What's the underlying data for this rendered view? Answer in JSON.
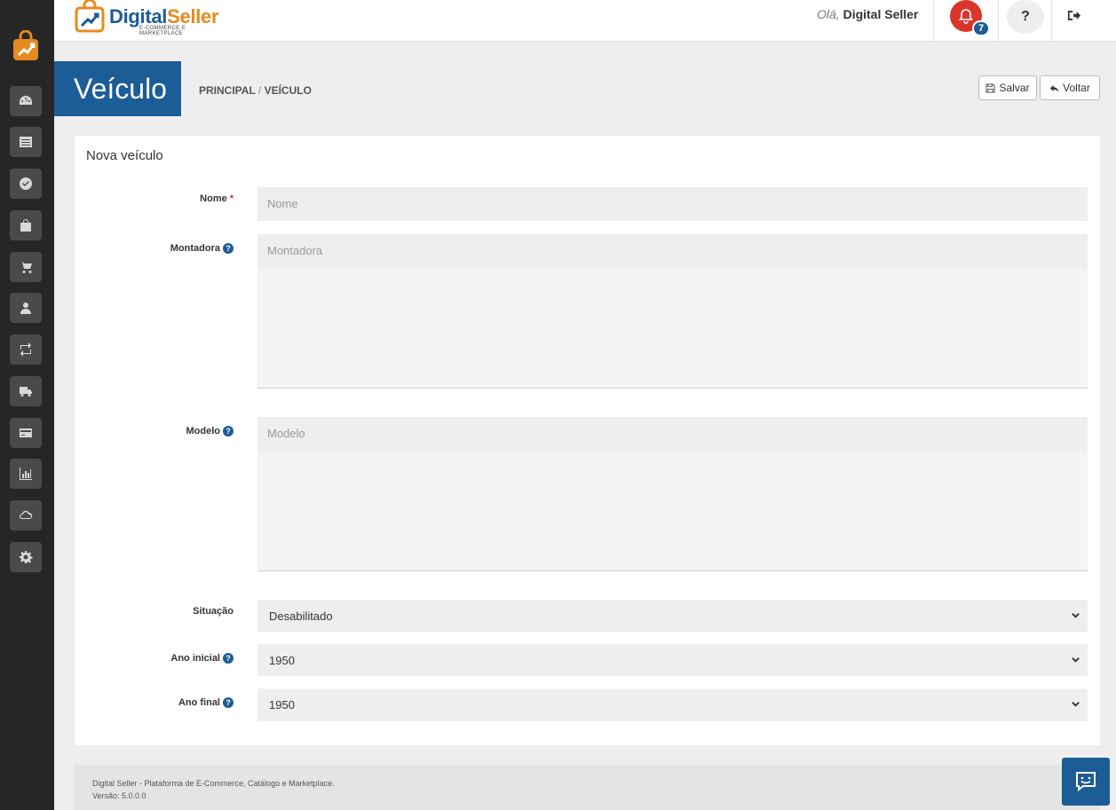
{
  "brand": {
    "name_part1": "Digital",
    "name_part2": "Seller",
    "tagline": "E-COMMERCE E MARKETPLACE",
    "accent": "#1c5c97",
    "orange": "#e8891f"
  },
  "header": {
    "greeting_prefix": "Olá,",
    "user_name": "Digital Seller",
    "notification_count": "7",
    "help_label": "?"
  },
  "sidebar": {
    "items": [
      {
        "icon": "dashboard-icon"
      },
      {
        "icon": "catalog-icon"
      },
      {
        "icon": "check-circle-icon"
      },
      {
        "icon": "shopping-bag-icon"
      },
      {
        "icon": "cart-icon"
      },
      {
        "icon": "user-icon"
      },
      {
        "icon": "retweet-icon"
      },
      {
        "icon": "truck-icon"
      },
      {
        "icon": "credit-card-icon"
      },
      {
        "icon": "bar-chart-icon"
      },
      {
        "icon": "cloud-icon"
      },
      {
        "icon": "gear-icon"
      }
    ]
  },
  "page": {
    "title": "Veículo",
    "breadcrumb_root": "PRINCIPAL",
    "breadcrumb_sep": "/",
    "breadcrumb_current": "VEÍCULO",
    "save_label": "Salvar",
    "back_label": "Voltar"
  },
  "form": {
    "title": "Nova veículo",
    "nome": {
      "label": "Nome",
      "required_mark": "*",
      "placeholder": "Nome"
    },
    "montadora": {
      "label": "Montadora",
      "placeholder": "Montadora"
    },
    "modelo": {
      "label": "Modelo",
      "placeholder": "Modelo"
    },
    "situacao": {
      "label": "Situação",
      "value": "Desabilitado"
    },
    "ano_inicial": {
      "label": "Ano inicial",
      "value": "1950"
    },
    "ano_final": {
      "label": "Ano final",
      "value": "1950"
    },
    "help_glyph": "?"
  },
  "footer": {
    "line1": "Digital Seller - Plataforma de E-Commerce, Catálogo e Marketplace.",
    "line2": "Versão: 5.0.0.0"
  }
}
